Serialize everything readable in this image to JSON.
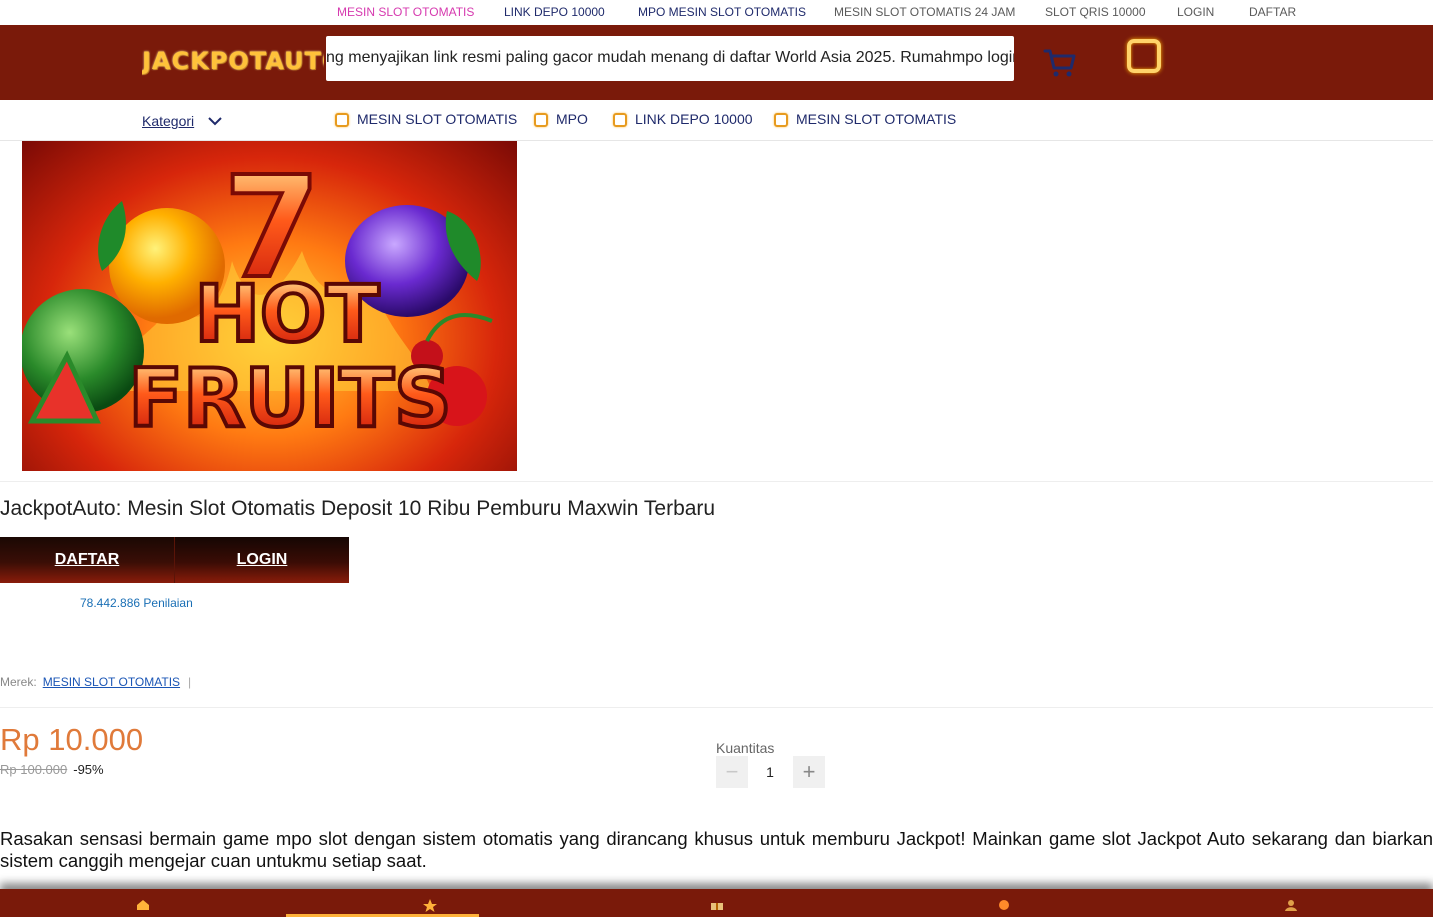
{
  "top_nav": [
    {
      "label": "MESIN SLOT OTOMATIS",
      "color": "#d63aaf"
    },
    {
      "label": "LINK DEPO 10000",
      "color": "#1f2a6b"
    },
    {
      "label": "MPO MESIN SLOT OTOMATIS",
      "color": "#1f2a6b"
    },
    {
      "label": "MESIN SLOT OTOMATIS 24 JAM",
      "color": "#8a8a8a"
    },
    {
      "label": "SLOT QRIS 10000",
      "color": "#8a8a8a"
    },
    {
      "label": "LOGIN",
      "color": "#8a8a8a"
    },
    {
      "label": "DAFTAR",
      "color": "#8a8a8a"
    }
  ],
  "header": {
    "logo_text": "JACKPOTAUTO",
    "search_marquee": "ng menyajikan link resmi paling gacor mudah menang di daftar World Asia 2025. Rumahmpo login",
    "cart_icon": "cart-icon",
    "square_icon": "square-icon"
  },
  "category_bar": {
    "kategori_label": "Kategori",
    "items": [
      {
        "label": "MESIN SLOT OTOMATIS"
      },
      {
        "label": "MPO"
      },
      {
        "label": "LINK DEPO 10000"
      },
      {
        "label": "MESIN SLOT OTOMATIS"
      }
    ]
  },
  "hero": {
    "line1": "7",
    "line2": "HOT",
    "line3": "FRUITS"
  },
  "product": {
    "title": "JackpotAuto: Mesin Slot Otomatis Deposit 10 Ribu Pemburu Maxwin Terbaru",
    "daftar_label": "DAFTAR",
    "login_label": "LOGIN",
    "rating_text": "78.442.886 Penilaian",
    "merek_label": "Merek:",
    "merek_value": "MESIN SLOT OTOMATIS",
    "merek_separator": "|",
    "price": "Rp 10.000",
    "old_price": "Rp 100.000",
    "discount": "-95%",
    "quantity_label": "Kuantitas",
    "quantity_value": "1",
    "quantity_minus": "−",
    "quantity_plus": "+",
    "description": "Rasakan sensasi bermain game mpo slot dengan sistem otomatis yang dirancang khusus untuk memburu Jackpot! Mainkan game slot Jackpot Auto sekarang dan biarkan sistem canggih mengejar cuan untukmu setiap saat."
  },
  "footer_icons": [
    "home-icon",
    "star-icon",
    "gift-icon",
    "chat-icon",
    "user-icon"
  ],
  "colors": {
    "header_bg": "#7a1a0a",
    "accent_gold": "#ffc23a",
    "price_orange": "#e07a3a",
    "nav_blue": "#1f2a6b"
  }
}
